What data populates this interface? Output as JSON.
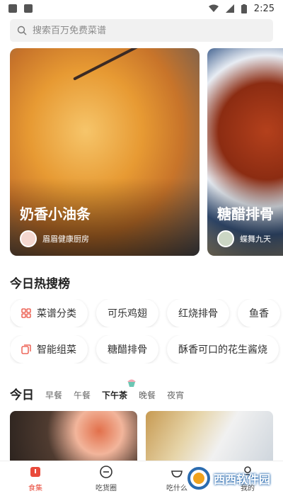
{
  "status_bar": {
    "time": "2:25"
  },
  "search": {
    "placeholder": "搜索百万免费菜谱"
  },
  "banners": [
    {
      "title": "奶香小油条",
      "author": "眉眉健康厨房"
    },
    {
      "title": "糖醋排骨",
      "author": "蝶舞九天"
    }
  ],
  "hot": {
    "title": "今日热搜榜",
    "row1": [
      {
        "label": "菜谱分类",
        "icon": "grid-icon"
      },
      {
        "label": "可乐鸡翅"
      },
      {
        "label": "红烧排骨"
      },
      {
        "label": "鱼香"
      }
    ],
    "row2": [
      {
        "label": "智能组菜",
        "icon": "layers-icon"
      },
      {
        "label": "糖醋排骨"
      },
      {
        "label": "酥香可口的花生酱烧"
      }
    ]
  },
  "tabs": {
    "main": "今日",
    "items": [
      "早餐",
      "午餐",
      "下午茶",
      "晚餐",
      "夜宵"
    ],
    "active": "下午茶"
  },
  "bottom_nav": [
    {
      "label": "食集",
      "icon": "home-icon",
      "active": true
    },
    {
      "label": "吃货圈",
      "icon": "chat-icon"
    },
    {
      "label": "吃什么",
      "icon": "bowl-icon"
    },
    {
      "label": "我的",
      "icon": "user-icon"
    }
  ],
  "watermark": {
    "text": "西西软件园"
  },
  "colors": {
    "accent": "#e94b3c",
    "chip_icon": "#e94b3c"
  }
}
